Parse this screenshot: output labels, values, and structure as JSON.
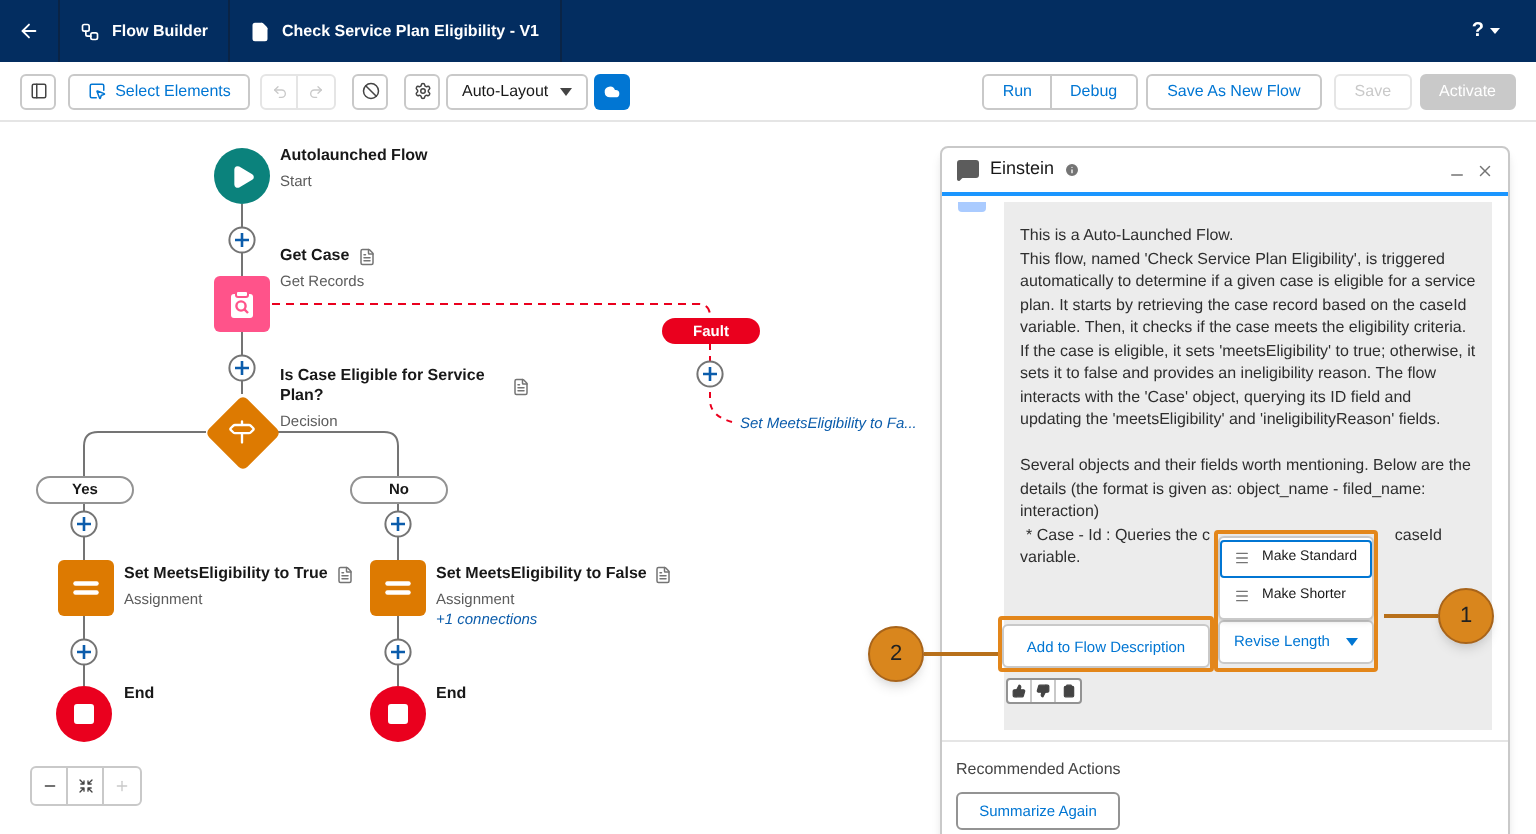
{
  "header": {
    "tabs": [
      {
        "label": "Flow Builder"
      },
      {
        "label": "Check Service Plan Eligibility - V1"
      }
    ],
    "help": "?"
  },
  "toolbar": {
    "select_button": "Select Elements",
    "undo_disabled": true,
    "redo_disabled": true,
    "layout": "Auto-Layout",
    "action_groups": [
      [
        {
          "label": "Run",
          "disabled": false
        },
        {
          "label": "Debug",
          "disabled": false
        }
      ],
      [
        {
          "label": "Save As New Flow",
          "disabled": false
        }
      ],
      [
        {
          "label": "Save",
          "disabled": true
        }
      ],
      [
        {
          "label": "Activate",
          "disabled": true
        }
      ]
    ]
  },
  "canvas": {
    "nodes": [
      {
        "kind": "start",
        "title": "Autolaunched Flow",
        "subtitle": "Start"
      },
      {
        "kind": "get_records",
        "title": "Get Case",
        "subtitle": "Get Records"
      },
      {
        "kind": "decision",
        "title": "Is Case Eligible for Service Plan?",
        "subtitle": "Decision"
      },
      {
        "kind": "assignment",
        "title": "Set MeetsEligibility to True",
        "subtitle": "Assignment"
      },
      {
        "kind": "assignment",
        "title": "Set MeetsEligibility to False",
        "subtitle": "Assignment",
        "link": "+1 connections"
      },
      {
        "kind": "end",
        "title": "End"
      },
      {
        "kind": "end",
        "title": "End"
      }
    ],
    "branches": [
      "Yes",
      "No"
    ],
    "fault": {
      "label": "Fault",
      "target": "Set MeetsEligibility to Fa..."
    },
    "zoom_in_disabled": true
  },
  "einstein": {
    "title": "Einstein",
    "paragraphs": [
      "This is a Auto-Launched Flow.",
      "This flow, named 'Check Service Plan Eligibility', is triggered automatically to determine if a given case is eligible for a service plan. It starts by retrieving the case record based on the caseId variable. Then, it checks if the case meets the eligibility criteria. If the case is eligible, it sets 'meetsEligibility' to true; otherwise, it sets it to false and provides an ineligibility reason. The flow interacts with the 'Case' object, querying its ID field and updating the 'meetsEligibility' and 'ineligibilityReason' fields.",
      "Several objects and their fields worth mentioning. Below are the details (the format is given as: object_name - filed_name: interaction)"
    ],
    "case_line": {
      "start": "* Case - Id : Queries the c",
      "end": "caseId",
      "last": "variable."
    },
    "menu": [
      {
        "label": "Make Standard",
        "selected": true
      },
      {
        "label": "Make Shorter",
        "selected": false
      }
    ],
    "add_button": "Add to Flow Description",
    "revise_button": "Revise Length",
    "recommended_title": "Recommended Actions",
    "summarize_button": "Summarize Again"
  },
  "callouts": [
    "1",
    "2"
  ]
}
